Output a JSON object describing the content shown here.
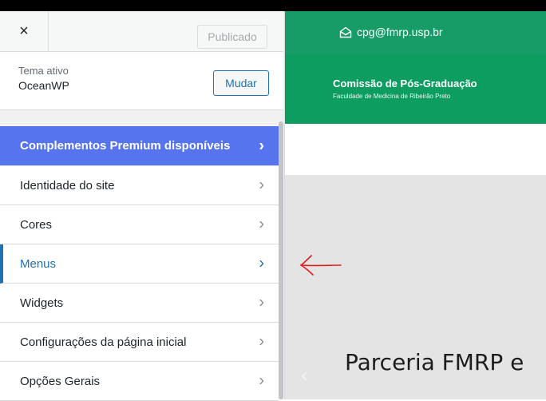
{
  "customizer": {
    "close_label": "×",
    "publish_label": "Publicado",
    "theme": {
      "label": "Tema ativo",
      "name": "OceanWP",
      "change_label": "Mudar"
    },
    "menu_items": [
      {
        "label": "Complementos Premium disponíveis",
        "state": "premium"
      },
      {
        "label": "Identidade do site"
      },
      {
        "label": "Cores"
      },
      {
        "label": "Menus",
        "state": "active"
      },
      {
        "label": "Widgets"
      },
      {
        "label": "Configurações da página inicial"
      },
      {
        "label": "Opções Gerais"
      }
    ],
    "chevron": "›"
  },
  "preview": {
    "email": "cpg@fmrp.usp.br",
    "site_title": "Comissão de Pós-Graduação",
    "site_subtitle": "Faculdade de Medicina de Ribeirão Preto",
    "slide_heading": "Parceria FMRP e",
    "slider_prev": "‹"
  },
  "colors": {
    "premium_bg": "#5674ed",
    "accent": "#2271b1",
    "header_green": "#0e9d61",
    "annotation_red": "#e0201b"
  },
  "icons": {
    "close": "close-icon",
    "chevron": "chevron-right-icon",
    "email": "envelope-open-icon",
    "annotation": "red-arrow-left-icon"
  }
}
